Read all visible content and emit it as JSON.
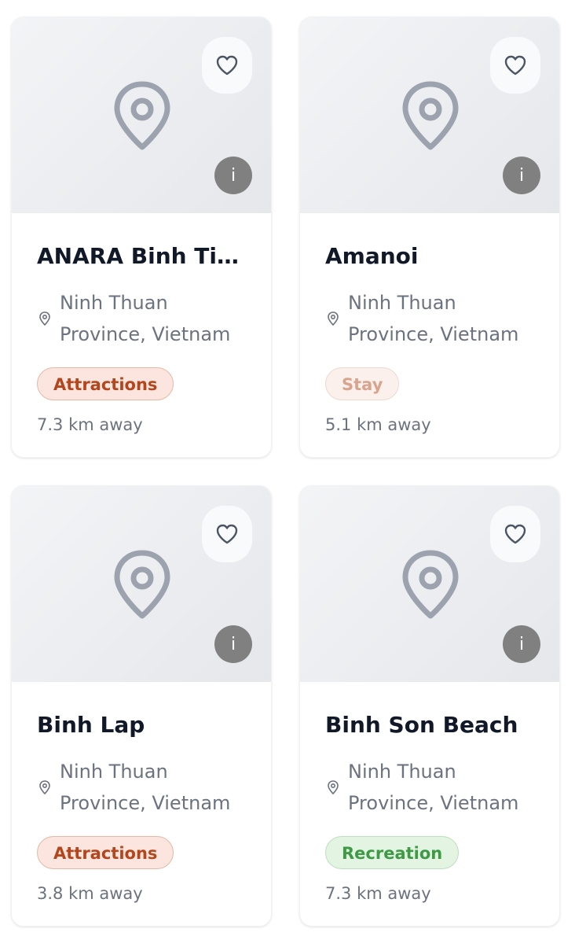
{
  "icons": {
    "favorite": "heart-outline-icon",
    "info": "info-icon",
    "image_placeholder": "map-pin-icon",
    "location": "map-pin-small-icon"
  },
  "colors": {
    "attractions": "#b3461c",
    "stay": "#d9a48e",
    "recreation": "#3e9a45",
    "info_button": "#808080"
  },
  "cards": [
    {
      "title": "ANARA Binh Tie...",
      "location": "Ninh Thuan Province, Vietnam",
      "category": "Attractions",
      "distance": "7.3 km away",
      "info_label": "i"
    },
    {
      "title": "Amanoi",
      "location": "Ninh Thuan Province, Vietnam",
      "category": "Stay",
      "distance": "5.1 km away",
      "info_label": "i"
    },
    {
      "title": "Binh Lap",
      "location": "Ninh Thuan Province, Vietnam",
      "category": "Attractions",
      "distance": "3.8 km away",
      "info_label": "i"
    },
    {
      "title": "Binh Son Beach",
      "location": "Ninh Thuan Province, Vietnam",
      "category": "Recreation",
      "distance": "7.3 km away",
      "info_label": "i"
    }
  ]
}
